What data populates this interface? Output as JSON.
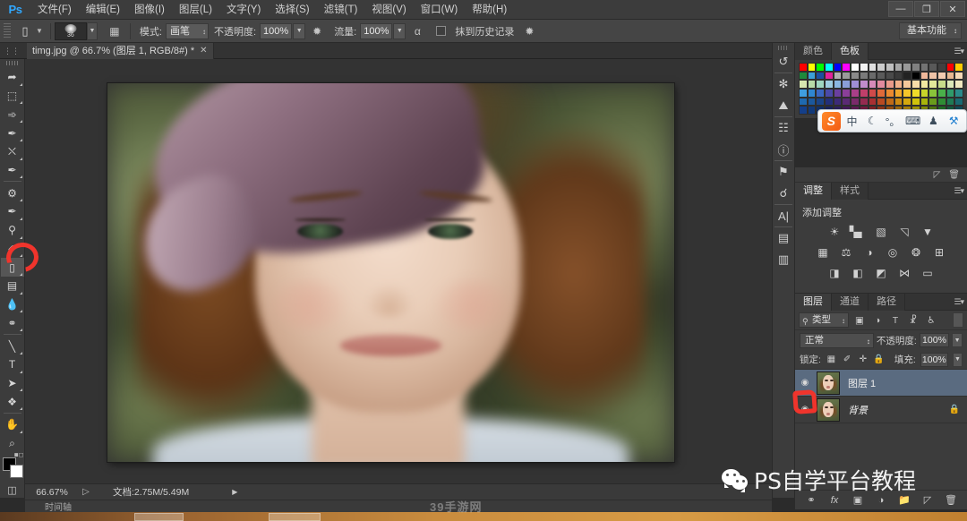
{
  "app": {
    "logo": "Ps",
    "workspace": "基本功能"
  },
  "menubar": {
    "items": [
      {
        "label": "文件(F)"
      },
      {
        "label": "编辑(E)"
      },
      {
        "label": "图像(I)"
      },
      {
        "label": "图层(L)"
      },
      {
        "label": "文字(Y)"
      },
      {
        "label": "选择(S)"
      },
      {
        "label": "滤镜(T)"
      },
      {
        "label": "视图(V)"
      },
      {
        "label": "窗口(W)"
      },
      {
        "label": "帮助(H)"
      }
    ],
    "window_controls": {
      "minimize": "—",
      "restore": "❐",
      "close": "✕"
    }
  },
  "options_bar": {
    "tool_icon": "eraser-icon",
    "brush_size": "36",
    "mode_label": "模式:",
    "mode_value": "画笔",
    "opacity_label": "不透明度:",
    "opacity_value": "100%",
    "flow_label": "流量:",
    "flow_value": "100%",
    "airbrush_icon": "airbrush-icon",
    "tablet_pressure_icon": "pressure-icon",
    "erase_to_history_label": "抹到历史记录",
    "erase_to_history_checked": false,
    "pressure_size_icon": "pressure-size-icon"
  },
  "document_tab": {
    "title": "timg.jpg @ 66.7% (图层 1, RGB/8#) *",
    "close": "✕"
  },
  "toolbar": {
    "tools": [
      {
        "name": "move-tool",
        "glyph": "↖",
        "active": false
      },
      {
        "name": "marquee-tool",
        "glyph": "⬚",
        "active": false
      },
      {
        "name": "lasso-tool",
        "glyph": "➦",
        "active": false
      },
      {
        "name": "quick-selection-tool",
        "glyph": "✒",
        "active": false
      },
      {
        "name": "crop-tool",
        "glyph": "⛌",
        "active": false
      },
      {
        "name": "eyedropper-tool",
        "glyph": "✒",
        "active": false
      },
      {
        "name": "healing-brush-tool",
        "glyph": "⌗",
        "active": false
      },
      {
        "name": "brush-tool",
        "glyph": "✎",
        "active": false
      },
      {
        "name": "clone-stamp-tool",
        "glyph": "⚓",
        "active": false
      },
      {
        "name": "history-brush-tool",
        "glyph": "✐",
        "active": false
      },
      {
        "name": "eraser-tool",
        "glyph": "▱",
        "active": true
      },
      {
        "name": "gradient-tool",
        "glyph": "▤",
        "active": false
      },
      {
        "name": "blur-tool",
        "glyph": "●",
        "active": false
      },
      {
        "name": "dodge-tool",
        "glyph": "⚲",
        "active": false
      },
      {
        "name": "pen-tool",
        "glyph": "✒",
        "active": false
      },
      {
        "name": "type-tool",
        "glyph": "T",
        "active": false
      },
      {
        "name": "path-selection-tool",
        "glyph": "▶",
        "active": false
      },
      {
        "name": "shape-tool",
        "glyph": "❖",
        "active": false
      },
      {
        "name": "hand-tool",
        "glyph": "✋",
        "active": false
      },
      {
        "name": "zoom-tool",
        "glyph": "⌕",
        "active": false
      }
    ],
    "foreground_color": "#000000",
    "background_color": "#ffffff",
    "quick_mask_icon": "quick-mask-icon"
  },
  "canvas": {
    "image_alt": "blurred portrait of a woman wearing a hat"
  },
  "status_bar": {
    "zoom": "66.67%",
    "doc_info": "文档:2.75M/5.49M",
    "arrow": "▶",
    "timeline_label": "时间轴"
  },
  "rail": {
    "icons": [
      {
        "name": "history-icon",
        "glyph": "↺"
      },
      {
        "name": "brush-presets-icon",
        "glyph": "✻"
      },
      {
        "name": "brush-icon",
        "glyph": "⛰"
      },
      {
        "name": "tool-presets-icon",
        "glyph": "☷"
      },
      {
        "name": "info-icon",
        "glyph": "ℹ"
      },
      {
        "name": "clone-source-icon",
        "glyph": "⚑"
      },
      {
        "name": "timeline-icon",
        "glyph": "⚌"
      },
      {
        "name": "character-icon",
        "glyph": "A"
      },
      {
        "name": "paragraph-icon",
        "glyph": "▤"
      },
      {
        "name": "notes-icon",
        "glyph": "▥"
      }
    ]
  },
  "color_panel": {
    "tabs": [
      {
        "label": "颜色",
        "active": false
      },
      {
        "label": "色板",
        "active": true
      }
    ],
    "menu_icon": "panel-menu-icon",
    "swatches": [
      "#ff0000",
      "#ffff00",
      "#00ff00",
      "#00ffff",
      "#0000ff",
      "#ff00ff",
      "#ffffff",
      "#f2f2f2",
      "#e0e0e0",
      "#cccccc",
      "#bfbfbf",
      "#a6a6a6",
      "#999999",
      "#808080",
      "#737373",
      "#595959",
      "#404040",
      "#ff0000",
      "#ffcc00",
      "#1e8a3c",
      "#3ba0d8",
      "#1a4fa0",
      "#e0219c",
      "#b0b0b0",
      "#9a9a9a",
      "#8a8a8a",
      "#7a7a7a",
      "#6a6a6a",
      "#5a5a5a",
      "#4a4a4a",
      "#3a3a3a",
      "#222222",
      "#000000",
      "#f0b89a",
      "#eec2a6",
      "#f2cbb0",
      "#e8b892",
      "#f5d9b8",
      "#d8e8b0",
      "#b8dca8",
      "#9fd6c0",
      "#9ecce0",
      "#8ab6e0",
      "#8a9ed8",
      "#9f8ed4",
      "#c08ccc",
      "#d68ab8",
      "#e08a9e",
      "#e89a8a",
      "#f0b08a",
      "#f5c89a",
      "#f7dca8",
      "#f2e8a0",
      "#e2e89a",
      "#c8dc8a",
      "#dce8b8",
      "#f0e8c0",
      "#3f9ee0",
      "#2f86d0",
      "#3a66c0",
      "#4a4aa8",
      "#6a3fa0",
      "#8a3f98",
      "#a83f88",
      "#c03f6a",
      "#d04a4a",
      "#e06a3a",
      "#ea8a30",
      "#f0a82a",
      "#f4c62a",
      "#f0dc2a",
      "#c8d42a",
      "#8ac43a",
      "#4ab04a",
      "#2f9a6a",
      "#2a8a8a",
      "#1f6ab0",
      "#1b589c",
      "#1a4488",
      "#232f7a",
      "#3c2a78",
      "#5a2a74",
      "#7a2a6a",
      "#942a50",
      "#a82f32",
      "#b84a22",
      "#c06a18",
      "#cc8a12",
      "#d4a80e",
      "#cfc20c",
      "#a8b40c",
      "#6a9c1c",
      "#2f8c34",
      "#1f7a54",
      "#1a6a72",
      "#143f8a",
      "#123a7a",
      "#113068",
      "#19235e",
      "#2c1e5e",
      "#44195a",
      "#5c1a52",
      "#70193e",
      "#7e2026",
      "#8c3418",
      "#944c10",
      "#9e660a",
      "#a67e06",
      "#a09406",
      "#7e8a06",
      "#4e7410",
      "#1f6a22",
      "#13583c",
      "#0f4a56"
    ]
  },
  "ime": {
    "logo": "S",
    "buttons": [
      {
        "name": "ime-mode-chinese",
        "glyph": "中"
      },
      {
        "name": "ime-moon-icon",
        "glyph": "☾"
      },
      {
        "name": "ime-punctuation-icon",
        "glyph": "°。"
      },
      {
        "name": "ime-keyboard-icon",
        "glyph": "⌨"
      },
      {
        "name": "ime-user-icon",
        "glyph": "♟"
      },
      {
        "name": "ime-settings-icon",
        "glyph": "⚒"
      }
    ]
  },
  "adjustments_panel": {
    "tabs": [
      {
        "label": "调整",
        "active": true
      },
      {
        "label": "样式",
        "active": false
      }
    ],
    "title": "添加调整",
    "toolstrip": [
      {
        "name": "new-adjustment-icon",
        "glyph": "◰"
      },
      {
        "name": "delete-adjustment-icon",
        "glyph": "🗑"
      }
    ],
    "rows": [
      [
        {
          "name": "brightness-contrast-icon",
          "glyph": "☀"
        },
        {
          "name": "levels-icon",
          "glyph": "ᴸ"
        },
        {
          "name": "curves-icon",
          "glyph": "⤳"
        },
        {
          "name": "exposure-icon",
          "glyph": "◱"
        },
        {
          "name": "vibrance-icon",
          "glyph": "▽"
        }
      ],
      [
        {
          "name": "hue-saturation-icon",
          "glyph": "▦"
        },
        {
          "name": "color-balance-icon",
          "glyph": "⚖"
        },
        {
          "name": "black-white-icon",
          "glyph": "◑"
        },
        {
          "name": "photo-filter-icon",
          "glyph": "◎"
        },
        {
          "name": "channel-mixer-icon",
          "glyph": "❂"
        },
        {
          "name": "color-lookup-icon",
          "glyph": "⊞"
        }
      ],
      [
        {
          "name": "invert-icon",
          "glyph": "◨"
        },
        {
          "name": "posterize-icon",
          "glyph": "◧"
        },
        {
          "name": "threshold-icon",
          "glyph": "◩"
        },
        {
          "name": "gradient-map-icon",
          "glyph": "⋈"
        },
        {
          "name": "selective-color-icon",
          "glyph": "▭"
        }
      ]
    ]
  },
  "layers_panel": {
    "tabs": [
      {
        "label": "图层",
        "active": true
      },
      {
        "label": "通道",
        "active": false
      },
      {
        "label": "路径",
        "active": false
      }
    ],
    "menu_icon": "panel-menu-icon",
    "filter": {
      "search_icon": "search-icon",
      "type_label": "类型",
      "caret": "↕",
      "icons": [
        {
          "name": "filter-pixel-icon",
          "glyph": "▣"
        },
        {
          "name": "filter-adjustment-icon",
          "glyph": "◑"
        },
        {
          "name": "filter-type-icon",
          "glyph": "T"
        },
        {
          "name": "filter-shape-icon",
          "glyph": "⌧"
        },
        {
          "name": "filter-smart-icon",
          "glyph": "⚿"
        }
      ]
    },
    "blend_mode": "正常",
    "opacity_label": "不透明度:",
    "opacity_value": "100%",
    "lock_label": "锁定:",
    "lock_icons": [
      {
        "name": "lock-transparent-icon",
        "glyph": "▦"
      },
      {
        "name": "lock-image-icon",
        "glyph": "✐"
      },
      {
        "name": "lock-position-icon",
        "glyph": "✛"
      },
      {
        "name": "lock-all-icon",
        "glyph": "🔒"
      }
    ],
    "fill_label": "填充:",
    "fill_value": "100%",
    "layers": [
      {
        "name": "图层 1",
        "visible": true,
        "selected": true,
        "locked": false,
        "italic": false
      },
      {
        "name": "背景",
        "visible": true,
        "selected": false,
        "locked": true,
        "italic": true
      }
    ],
    "eye_glyph": "◉",
    "lock_glyph": "🔒",
    "footer_icons": [
      {
        "name": "link-layers-icon",
        "glyph": "⚭"
      },
      {
        "name": "layer-style-icon",
        "glyph": "fx"
      },
      {
        "name": "layer-mask-icon",
        "glyph": "▣"
      },
      {
        "name": "new-fill-adjustment-icon",
        "glyph": "◑"
      },
      {
        "name": "new-group-icon",
        "glyph": "📁"
      },
      {
        "name": "new-layer-icon",
        "glyph": "◰"
      },
      {
        "name": "delete-layer-icon",
        "glyph": "🗑"
      }
    ]
  },
  "watermarks": {
    "wechat_text": "PS自学平台教程",
    "site_text": "39手游网"
  },
  "annotations": {
    "tool_circle_color": "#f0342c",
    "layer_mark_color": "#f0342c"
  }
}
